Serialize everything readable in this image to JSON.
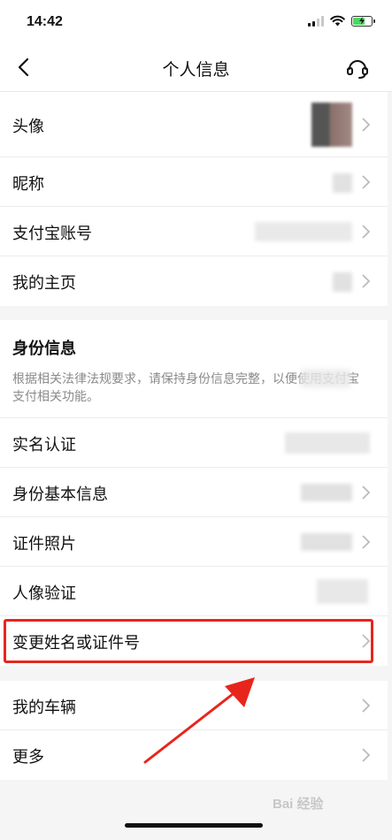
{
  "status_bar": {
    "time": "14:42"
  },
  "nav": {
    "title": "个人信息"
  },
  "profile": {
    "items": [
      {
        "label": "头像"
      },
      {
        "label": "昵称"
      },
      {
        "label": "支付宝账号"
      },
      {
        "label": "我的主页"
      }
    ]
  },
  "identity": {
    "title": "身份信息",
    "description": "根据相关法律法规要求，请保持身份信息完整，以便使用支付宝支付相关功能。",
    "items": [
      {
        "label": "实名认证"
      },
      {
        "label": "身份基本信息"
      },
      {
        "label": "证件照片"
      },
      {
        "label": "人像验证"
      },
      {
        "label": "变更姓名或证件号"
      }
    ]
  },
  "other": {
    "items": [
      {
        "label": "我的车辆"
      },
      {
        "label": "更多"
      }
    ]
  },
  "annotation": {
    "highlight_color": "#e8251c"
  },
  "watermark": "Bai 经验"
}
